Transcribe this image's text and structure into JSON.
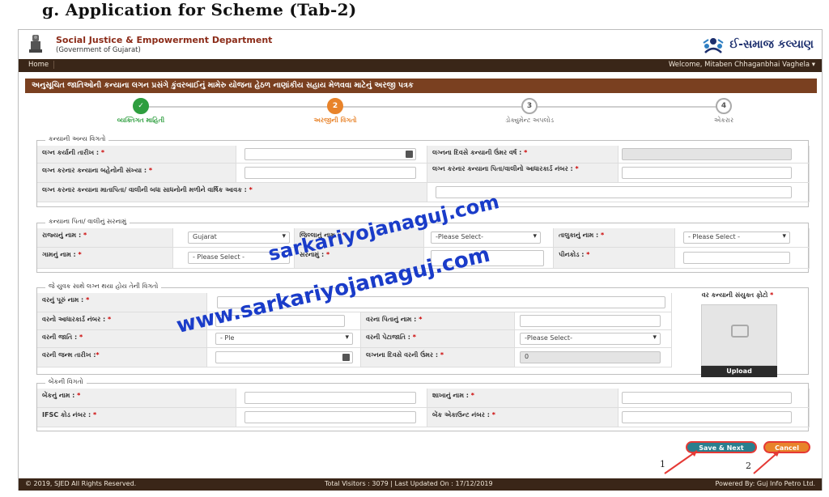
{
  "doc_heading": "g.  Application for Scheme (Tab-2)",
  "header": {
    "dept_name": "Social Justice & Empowerment Department",
    "dept_sub": "(Government of Gujarat)",
    "brand": "ઈ-સમાજ કલ્યાણ"
  },
  "nav": {
    "home": "Home",
    "welcome": "Welcome, Mitaben Chhaganbhai Vaghela  ▾"
  },
  "title_bar": "અનુસૂચિત જાતિઓની કન્યાના લગન પ્રસંગે કુંવરબાઈનું મામેરુ યોજના હેઠળ નાણાંકીય સહાય મેળવવા માટેનું અરજી પત્રક",
  "steps": [
    {
      "number": "✓",
      "label": "વ્યક્તિગત માહિતી",
      "state": "done"
    },
    {
      "number": "2",
      "label": "અરજીની વિગતો",
      "state": "active"
    },
    {
      "number": "3",
      "label": "ડોક્યુમેન્ટ અપલોડ",
      "state": "pending"
    },
    {
      "number": "4",
      "label": "એકરાર",
      "state": "pending"
    }
  ],
  "section1": {
    "legend": "કન્યાની અન્ય વિગતો",
    "marriage_date_label": "લગ્ન કર્યાની તારીખ :",
    "age_on_marriage_label": "લગ્નના દિવસે કન્યાની ઉંમર વર્ષ :",
    "sisters_count_label": "લગ્ન કરનાર કન્યાના બહેનોની સંખ્યા :",
    "father_aadhaar_label": "લગ્ન કરનાર કન્યાના પિતા/વાલીનો આધારકાર્ડ નંબર :",
    "annual_income_label": "લગ્ન કરનાર કન્યાના માતાપિતા/ વાલીની બધા સાધનોની મળીને વાર્ષિક આવક :"
  },
  "section2": {
    "legend": "કન્યાના પિતા/ વાલીનું સરનામું",
    "state_label": "રાજ્યનું નામ :",
    "state_value": "Gujarat",
    "district_label": "જિલ્લાનું નામ :",
    "district_value": "-Please Select-",
    "taluka_label": "તાલુકાનું નામ :",
    "taluka_value": "- Please Select -",
    "village_label": "ગામનું નામ :",
    "village_value": "- Please Select -",
    "address_label": "સરનામું :",
    "pincode_label": "પીનકોડ :"
  },
  "section3": {
    "legend": "જે યુવક સાથે લગ્ન થયા હોય તેની વિગતો",
    "groom_name_label": "વરનું પૂરું નામ :",
    "groom_aadhaar_label": "વરનો આધારકાર્ડ નંબર :",
    "groom_father_label": "વરના પિતાનું નામ :",
    "groom_caste_label": "વરની જાતિ :",
    "groom_caste_value": "- Ple",
    "groom_subcaste_label": "વરની પેટાજાતિ :",
    "groom_subcaste_value": "-Please Select-",
    "groom_dob_label": "વરની જન્મ તારીખ :",
    "groom_age_label": "લગ્નના દિવસે વરની ઉંમર :",
    "groom_age_value": "0",
    "photo_label": "વર કન્યાની સંયુક્ત ફોટો",
    "upload_label": "Upload"
  },
  "section4": {
    "legend": "બેંકની વિગતો",
    "bank_name_label": "બેંકનું નામ :",
    "branch_label": "શાખાનું નામ :",
    "ifsc_label": "IFSC કોડ નંબર :",
    "account_label": "બેંક એકાઉન્ટ નંબર :"
  },
  "buttons": {
    "save_next": "Save & Next",
    "cancel": "Cancel",
    "marker1": "1",
    "marker2": "2"
  },
  "footer": {
    "copyright": "© 2019, SJED All Rights Reserved.",
    "visitors": "Total Visitors : 3079 | Last Updated On : 17/12/2019",
    "powered": "Powered By: Guj Info Petro Ltd."
  },
  "watermark": {
    "line1": "sarkariyojanaguj.com",
    "line2": "www.sarkariyojanaguj.com"
  },
  "colors": {
    "nav_bg": "#3a2618",
    "title_bg": "#7a4020",
    "done": "#2e9e3f",
    "active": "#e8832a",
    "watermark": "#1a3cc9"
  }
}
